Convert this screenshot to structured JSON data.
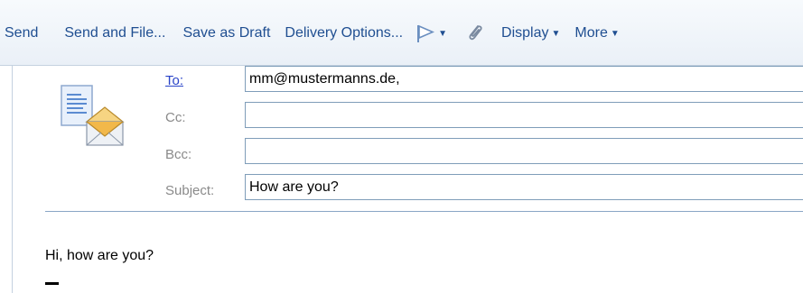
{
  "toolbar": {
    "send_label": "Send",
    "send_file_label": "Send and File...",
    "save_draft_label": "Save as Draft",
    "delivery_label": "Delivery Options...",
    "display_label": "Display",
    "more_label": "More"
  },
  "fields": {
    "to_label": "To:",
    "to_value": "mm@mustermanns.de,",
    "cc_label": "Cc:",
    "cc_value": "",
    "bcc_label": "Bcc:",
    "bcc_value": "",
    "subject_label": "Subject:",
    "subject_value": "How are you?"
  },
  "body": {
    "text": "Hi, how are you?"
  },
  "icons": {
    "flag": "flag-icon",
    "attach": "paperclip-icon",
    "dropdown": "caret-down-icon",
    "envelope": "envelope-icon"
  },
  "colors": {
    "toolbar_text": "#1f4e91",
    "link_label": "#2a44c8",
    "muted_label": "#8a8a8a",
    "input_border": "#7f9db9",
    "divider": "#8aa6c6"
  }
}
